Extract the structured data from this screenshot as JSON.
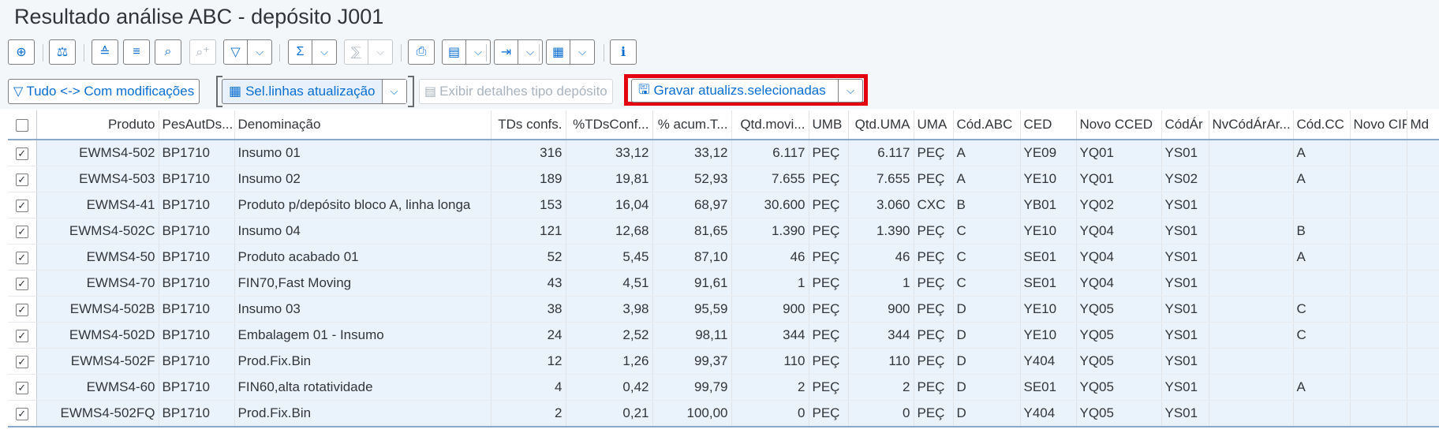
{
  "title": "Resultado análise ABC - depósito J001",
  "toolbar1": {
    "icons": [
      "zoom-details-icon",
      "compare-icon",
      "sort-ascending-icon",
      "sort-descending-icon",
      "find-icon",
      "find-next-icon",
      "filter-icon",
      "sum-icon",
      "subtotal-icon",
      "print-icon",
      "print-preview-icon",
      "export-icon",
      "layout-icon",
      "info-icon"
    ]
  },
  "toolbar2": {
    "toggle_label": "Tudo <-> Com modificações",
    "select_rows_label": "Sel.linhas atualização",
    "details_label": "Exibir detalhes tipo depósito",
    "save_label": "Gravar atualizs.selecionadas"
  },
  "icon_glyphs": {
    "zoom": "⊕",
    "compare": "⚖",
    "sort_asc": "≙",
    "sort_desc": "≡",
    "find": "⌕",
    "find_next": "⌕⁺",
    "filter": "▽",
    "sum": "Σ",
    "subtotal": "⅀",
    "print": "⎙",
    "preview": "▤",
    "export": "⇥",
    "layout": "▦",
    "info": "ℹ",
    "chev": "⌵",
    "check": "✓",
    "save": "🖫"
  },
  "table": {
    "columns": [
      "Produto",
      "PesAutDs...",
      "Denominação",
      "TDs confs.",
      "%TDsConf...",
      "% acum.T...",
      "Qtd.movi...",
      "UMB",
      "Qtd.UMA",
      "UMA",
      "Cód.ABC",
      "CED",
      "Novo CCED",
      "CódÁr",
      "NvCódÁrAr...",
      "Cód.CC",
      "Novo CIR",
      "Md"
    ],
    "rows": [
      [
        "EWMS4-502",
        "BP1710",
        "Insumo 01",
        "316",
        "33,12",
        "33,12",
        "6.117",
        "PEÇ",
        "6.117",
        "PEÇ",
        "A",
        "YE09",
        "YQ01",
        "YS01",
        "",
        "A",
        "",
        ""
      ],
      [
        "EWMS4-503",
        "BP1710",
        "Insumo 02",
        "189",
        "19,81",
        "52,93",
        "7.655",
        "PEÇ",
        "7.655",
        "PEÇ",
        "A",
        "YE10",
        "YQ01",
        "YS02",
        "",
        "A",
        "",
        ""
      ],
      [
        "EWMS4-41",
        "BP1710",
        "Produto p/depósito bloco A, linha longa",
        "153",
        "16,04",
        "68,97",
        "30.600",
        "PEÇ",
        "3.060",
        "CXC",
        "B",
        "YB01",
        "YQ02",
        "YS01",
        "",
        "",
        "",
        ""
      ],
      [
        "EWMS4-502C",
        "BP1710",
        "Insumo 04",
        "121",
        "12,68",
        "81,65",
        "1.390",
        "PEÇ",
        "1.390",
        "PEÇ",
        "C",
        "YE10",
        "YQ04",
        "YS01",
        "",
        "B",
        "",
        ""
      ],
      [
        "EWMS4-50",
        "BP1710",
        "Produto acabado 01",
        "52",
        "5,45",
        "87,10",
        "46",
        "PEÇ",
        "46",
        "PEÇ",
        "C",
        "SE01",
        "YQ04",
        "YS01",
        "",
        "A",
        "",
        ""
      ],
      [
        "EWMS4-70",
        "BP1710",
        "FIN70,Fast Moving",
        "43",
        "4,51",
        "91,61",
        "1",
        "PEÇ",
        "1",
        "PEÇ",
        "C",
        "SE01",
        "YQ04",
        "YS01",
        "",
        "",
        "",
        ""
      ],
      [
        "EWMS4-502B",
        "BP1710",
        "Insumo 03",
        "38",
        "3,98",
        "95,59",
        "900",
        "PEÇ",
        "900",
        "PEÇ",
        "D",
        "YE10",
        "YQ05",
        "YS01",
        "",
        "C",
        "",
        ""
      ],
      [
        "EWMS4-502D",
        "BP1710",
        "Embalagem 01 - Insumo",
        "24",
        "2,52",
        "98,11",
        "344",
        "PEÇ",
        "344",
        "PEÇ",
        "D",
        "YE10",
        "YQ05",
        "YS01",
        "",
        "C",
        "",
        ""
      ],
      [
        "EWMS4-502F",
        "BP1710",
        "Prod.Fix.Bin",
        "12",
        "1,26",
        "99,37",
        "110",
        "PEÇ",
        "110",
        "PEÇ",
        "D",
        "Y404",
        "YQ05",
        "YS01",
        "",
        "",
        "",
        ""
      ],
      [
        "EWMS4-60",
        "BP1710",
        "FIN60,alta rotatividade",
        "4",
        "0,42",
        "99,79",
        "2",
        "PEÇ",
        "2",
        "PEÇ",
        "D",
        "SE01",
        "YQ05",
        "YS01",
        "",
        "A",
        "",
        ""
      ],
      [
        "EWMS4-502FQ",
        "BP1710",
        "Prod.Fix.Bin",
        "2",
        "0,21",
        "100,00",
        "0",
        "PEÇ",
        "0",
        "PEÇ",
        "D",
        "Y404",
        "YQ05",
        "YS01",
        "",
        "",
        "",
        ""
      ]
    ]
  }
}
